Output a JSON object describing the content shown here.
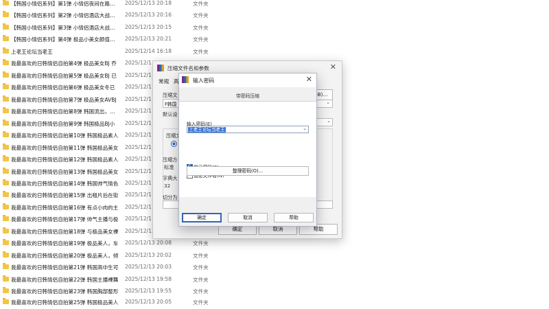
{
  "files": [
    {
      "name": "【韩国小情侣系列】第1弹 小情侣夜间在路上吃",
      "date": "2025/12/13 20:18",
      "type": "文件夹"
    },
    {
      "name": "【韩国小情侣系列】第2弹 小情侣酒店大战，女",
      "date": "2025/12/13 20:16",
      "type": "文件夹"
    },
    {
      "name": "【韩国小情侣系列】第3弹 小情侣酒店大战，女",
      "date": "2025/12/13 20:15",
      "type": "文件夹"
    },
    {
      "name": "【韩国小情侣系列】第4弹 极品小美女颜值反差",
      "date": "2025/12/13 20:21",
      "type": "文件夹"
    },
    {
      "name": "上老王论坛当老王",
      "date": "2025/12/14 16:18",
      "type": "文件夹"
    },
    {
      "name": "我最喜欢的日韩情侣自拍第4弹 极品美女BJ 乔",
      "date": "2025/12/1",
      "type": ""
    },
    {
      "name": "我最喜欢的日韩情侣自拍第5弹 极品美女BJ 已",
      "date": "2025/12/1",
      "type": ""
    },
    {
      "name": "我最喜欢的日韩情侣自拍第6弹 极品美女冬已",
      "date": "2025/12/1",
      "type": ""
    },
    {
      "name": "我最喜欢的日韩情侣自拍第7弹 极品美女AVBJ",
      "date": "2025/12/1",
      "type": ""
    },
    {
      "name": "我最喜欢的日韩情侣自拍第8弹 韩国流出，按摩",
      "date": "2025/12/1",
      "type": ""
    },
    {
      "name": "我最喜欢的日韩情侣自拍第9弹 韩国极品BJ小",
      "date": "2025/12/1",
      "type": ""
    },
    {
      "name": "我最喜欢的日韩情侣自拍第10弹 韩国极品素人",
      "date": "2025/12/1",
      "type": ""
    },
    {
      "name": "我最喜欢的日韩情侣自拍第11弹 韩国极品美女",
      "date": "2025/12/1",
      "type": ""
    },
    {
      "name": "我最喜欢的日韩情侣自拍第12弹 韩国极品素人",
      "date": "2025/12/1",
      "type": ""
    },
    {
      "name": "我最喜欢的日韩情侣自拍第13弹 韩国极品美女",
      "date": "2025/12/1",
      "type": ""
    },
    {
      "name": "我最喜欢的日韩情侣自拍第14弹 韩国帅气情色",
      "date": "2025/12/1",
      "type": ""
    },
    {
      "name": "我最喜欢的日韩情侣自拍第15弹 出租片后在街",
      "date": "2025/12/1",
      "type": ""
    },
    {
      "name": "我最喜欢的日韩情侣自拍第16弹 有点小肉的主",
      "date": "2025/12/1",
      "type": ""
    },
    {
      "name": "我最喜欢的日韩情侣自拍第17弹 帅气主播与极",
      "date": "2025/12/1",
      "type": ""
    },
    {
      "name": "我最喜欢的日韩情侣自拍第18弹 与极品美女裸",
      "date": "2025/12/13 20:0",
      "type": ""
    },
    {
      "name": "我最喜欢的日韩情侣自拍第19弹 极品美人，车",
      "date": "2025/12/13 20:08",
      "type": "文件夹"
    },
    {
      "name": "我最喜欢的日韩情侣自拍第20弹 极品美人，倾",
      "date": "2025/12/13 20:02",
      "type": "文件夹"
    },
    {
      "name": "我最喜欢的日韩情侣自拍第21弹 韩国高中生可",
      "date": "2025/12/13 20:03",
      "type": "文件夹"
    },
    {
      "name": "我最喜欢的日韩情侣自拍第22弹 韩国主播裸舞",
      "date": "2025/12/13 19:58",
      "type": "文件夹"
    },
    {
      "name": "我最喜欢的日韩情侣自拍第23弹 韩国胸部整形",
      "date": "2025/12/13 19:55",
      "type": "文件夹"
    },
    {
      "name": "我最喜欢的日韩情侣自拍第25弹 韩国极品美人",
      "date": "2025/12/13 20:05",
      "type": "文件夹"
    }
  ],
  "back_dialog": {
    "title": "压缩文件名和参数",
    "tabs": [
      "常规",
      "高"
    ],
    "labels": {
      "archive_name": "压缩文",
      "archive_value": "F韩国",
      "default_profile": "默认设",
      "format": "压缩文",
      "method": "压缩方",
      "method_value": "标准",
      "dict": "字典大",
      "dict_value": "32",
      "split": "切分为"
    },
    "buttons": {
      "browse": "B)...",
      "ok": "确定",
      "cancel": "取消",
      "help": "帮助"
    }
  },
  "password_dialog": {
    "title": "输入密码",
    "caption": "带密码压缩",
    "input_label": "输入密码(E)",
    "password_value": "上老王论坛当老王",
    "show_password_label": "显示密码(S)",
    "show_password_checked": true,
    "encrypt_names_label": "加密文件名(N)",
    "encrypt_names_checked": false,
    "manage_button": "整理密码(O)...",
    "ok_button": "确定",
    "cancel_button": "取消",
    "help_button": "帮助"
  }
}
